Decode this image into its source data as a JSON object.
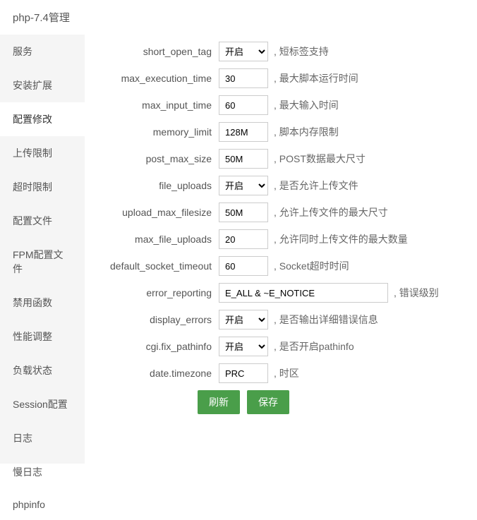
{
  "header": {
    "title": "php-7.4管理"
  },
  "sidebar": {
    "items": [
      {
        "label": "服务",
        "active": false
      },
      {
        "label": "安装扩展",
        "active": false
      },
      {
        "label": "配置修改",
        "active": true
      },
      {
        "label": "上传限制",
        "active": false
      },
      {
        "label": "超时限制",
        "active": false
      },
      {
        "label": "配置文件",
        "active": false
      },
      {
        "label": "FPM配置文件",
        "active": false
      },
      {
        "label": "禁用函数",
        "active": false
      },
      {
        "label": "性能调整",
        "active": false
      },
      {
        "label": "负载状态",
        "active": false
      },
      {
        "label": "Session配置",
        "active": false
      },
      {
        "label": "日志",
        "active": false
      },
      {
        "label": "慢日志",
        "active": false
      },
      {
        "label": "phpinfo",
        "active": false
      }
    ]
  },
  "form": {
    "rows": [
      {
        "label": "short_open_tag",
        "type": "select",
        "value": "开启",
        "desc": ", 短标签支持"
      },
      {
        "label": "max_execution_time",
        "type": "input",
        "value": "30",
        "desc": ", 最大脚本运行时间"
      },
      {
        "label": "max_input_time",
        "type": "input",
        "value": "60",
        "desc": ", 最大输入时间"
      },
      {
        "label": "memory_limit",
        "type": "input",
        "value": "128M",
        "desc": ", 脚本内存限制"
      },
      {
        "label": "post_max_size",
        "type": "input",
        "value": "50M",
        "desc": ", POST数据最大尺寸"
      },
      {
        "label": "file_uploads",
        "type": "select",
        "value": "开启",
        "desc": ", 是否允许上传文件"
      },
      {
        "label": "upload_max_filesize",
        "type": "input",
        "value": "50M",
        "desc": ", 允许上传文件的最大尺寸"
      },
      {
        "label": "max_file_uploads",
        "type": "input",
        "value": "20",
        "desc": ", 允许同时上传文件的最大数量"
      },
      {
        "label": "default_socket_timeout",
        "type": "input",
        "value": "60",
        "desc": ", Socket超时时间"
      },
      {
        "label": "error_reporting",
        "type": "input-wide",
        "value": "E_ALL & ~E_NOTICE",
        "desc": ", 错误级别"
      },
      {
        "label": "display_errors",
        "type": "select",
        "value": "开启",
        "desc": ", 是否输出详细错误信息"
      },
      {
        "label": "cgi.fix_pathinfo",
        "type": "select",
        "value": "开启",
        "desc": ", 是否开启pathinfo"
      },
      {
        "label": "date.timezone",
        "type": "input",
        "value": "PRC",
        "desc": ", 时区"
      }
    ],
    "buttons": {
      "refresh": "刷新",
      "save": "保存"
    }
  }
}
